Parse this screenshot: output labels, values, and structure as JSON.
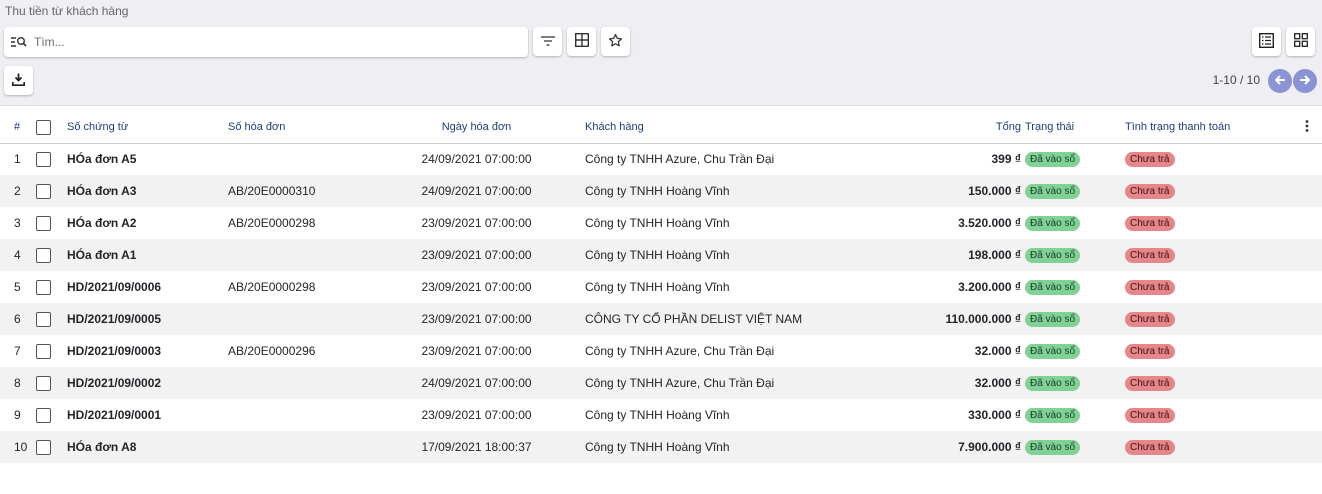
{
  "page": {
    "title": "Thu tiền từ khách hàng"
  },
  "search": {
    "placeholder": "Tìm..."
  },
  "pager": {
    "label": "1-10 / 10"
  },
  "table": {
    "headers": {
      "num": "#",
      "so_chung_tu": "Số chứng từ",
      "so_hoa_don": "Số hóa đơn",
      "ngay_hoa_don": "Ngày hóa đơn",
      "khach_hang": "Khách hàng",
      "tong": "Tổng",
      "trang_thai": "Trạng thái",
      "tinh_trang": "Tình trạng thanh toán"
    },
    "rows": [
      {
        "num": "1",
        "so_chung_tu": "HÓa đơn A5",
        "so_hoa_don": "",
        "ngay": "24/09/2021 07:00:00",
        "khach_hang": "Công ty TNHH Azure, Chu Trần Đại",
        "tong": "399 ₫",
        "trang_thai": "Đã vào sổ",
        "tinh_trang": "Chưa trả"
      },
      {
        "num": "2",
        "so_chung_tu": "HÓa đơn A3",
        "so_hoa_don": "AB/20E0000310",
        "ngay": "24/09/2021 07:00:00",
        "khach_hang": "Công ty TNHH Hoàng Vĩnh",
        "tong": "150.000 ₫",
        "trang_thai": "Đã vào sổ",
        "tinh_trang": "Chưa trả"
      },
      {
        "num": "3",
        "so_chung_tu": "HÓa đơn A2",
        "so_hoa_don": "AB/20E0000298",
        "ngay": "23/09/2021 07:00:00",
        "khach_hang": "Công ty TNHH Hoàng Vĩnh",
        "tong": "3.520.000 ₫",
        "trang_thai": "Đã vào sổ",
        "tinh_trang": "Chưa trả"
      },
      {
        "num": "4",
        "so_chung_tu": "HÓa đơn A1",
        "so_hoa_don": "",
        "ngay": "23/09/2021 07:00:00",
        "khach_hang": "Công ty TNHH Hoàng Vĩnh",
        "tong": "198.000 ₫",
        "trang_thai": "Đã vào sổ",
        "tinh_trang": "Chưa trả"
      },
      {
        "num": "5",
        "so_chung_tu": "HD/2021/09/0006",
        "so_hoa_don": "AB/20E0000298",
        "ngay": "23/09/2021 07:00:00",
        "khach_hang": "Công ty TNHH Hoàng Vĩnh",
        "tong": "3.200.000 ₫",
        "trang_thai": "Đã vào sổ",
        "tinh_trang": "Chưa trả"
      },
      {
        "num": "6",
        "so_chung_tu": "HD/2021/09/0005",
        "so_hoa_don": "",
        "ngay": "23/09/2021 07:00:00",
        "khach_hang": "CÔNG TY CỔ PHẦN DELIST VIỆT NAM",
        "tong": "110.000.000 ₫",
        "trang_thai": "Đã vào sổ",
        "tinh_trang": "Chưa trả"
      },
      {
        "num": "7",
        "so_chung_tu": "HD/2021/09/0003",
        "so_hoa_don": "AB/20E0000296",
        "ngay": "23/09/2021 07:00:00",
        "khach_hang": "Công ty TNHH Azure, Chu Trần Đại",
        "tong": "32.000 ₫",
        "trang_thai": "Đã vào sổ",
        "tinh_trang": "Chưa trả"
      },
      {
        "num": "8",
        "so_chung_tu": "HD/2021/09/0002",
        "so_hoa_don": "",
        "ngay": "24/09/2021 07:00:00",
        "khach_hang": "Công ty TNHH Azure, Chu Trần Đại",
        "tong": "32.000 ₫",
        "trang_thai": "Đã vào sổ",
        "tinh_trang": "Chưa trả"
      },
      {
        "num": "9",
        "so_chung_tu": "HD/2021/09/0001",
        "so_hoa_don": "",
        "ngay": "23/09/2021 07:00:00",
        "khach_hang": "Công ty TNHH Hoàng Vĩnh",
        "tong": "330.000 ₫",
        "trang_thai": "Đã vào sổ",
        "tinh_trang": "Chưa trả"
      },
      {
        "num": "10",
        "so_chung_tu": "HÓa đơn A8",
        "so_hoa_don": "",
        "ngay": "17/09/2021 18:00:37",
        "khach_hang": "Công ty TNHH Hoàng Vĩnh",
        "tong": "7.900.000 ₫",
        "trang_thai": "Đã vào sổ",
        "tinh_trang": "Chưa trả"
      }
    ]
  },
  "colors": {
    "accent": "#8a93d4",
    "header_text": "#1f3c7a",
    "badge_posted": "#7fd194",
    "badge_unpaid": "#e5868b"
  }
}
